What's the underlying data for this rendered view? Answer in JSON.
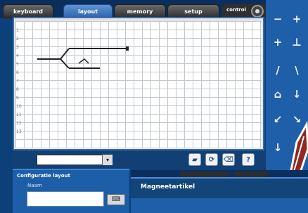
{
  "tabs": [
    {
      "label": "keyboard",
      "active": false
    },
    {
      "label": "layout",
      "active": true
    },
    {
      "label": "memory",
      "active": false
    },
    {
      "label": "setup",
      "active": false
    }
  ],
  "control": {
    "label": "control"
  },
  "grid": {
    "row_numbers": [
      "1",
      "2",
      "3",
      "4",
      "5",
      "6",
      "7",
      "8",
      "9",
      "10",
      "11",
      "12",
      "13"
    ]
  },
  "toolbar": {
    "dropdown_value": "",
    "icons": [
      "track-piece-icon",
      "rotate-icon",
      "delete-icon",
      "help-icon"
    ],
    "help_label": "?"
  },
  "right_rail": {
    "buttons": [
      "−",
      "+",
      "+",
      "⊥",
      "/",
      "\\",
      "⌂",
      "↓",
      "↙",
      "↘",
      "↓"
    ]
  },
  "config": {
    "title": "Configuratie layout",
    "naam_label": "Naam",
    "naam_value": ""
  },
  "magneet": {
    "title": "Magneetartikel"
  },
  "colors": {
    "background": "#0d3f78",
    "accent": "#2d64ad",
    "track": "#222222",
    "grid_lines": "#c3c8ce"
  }
}
